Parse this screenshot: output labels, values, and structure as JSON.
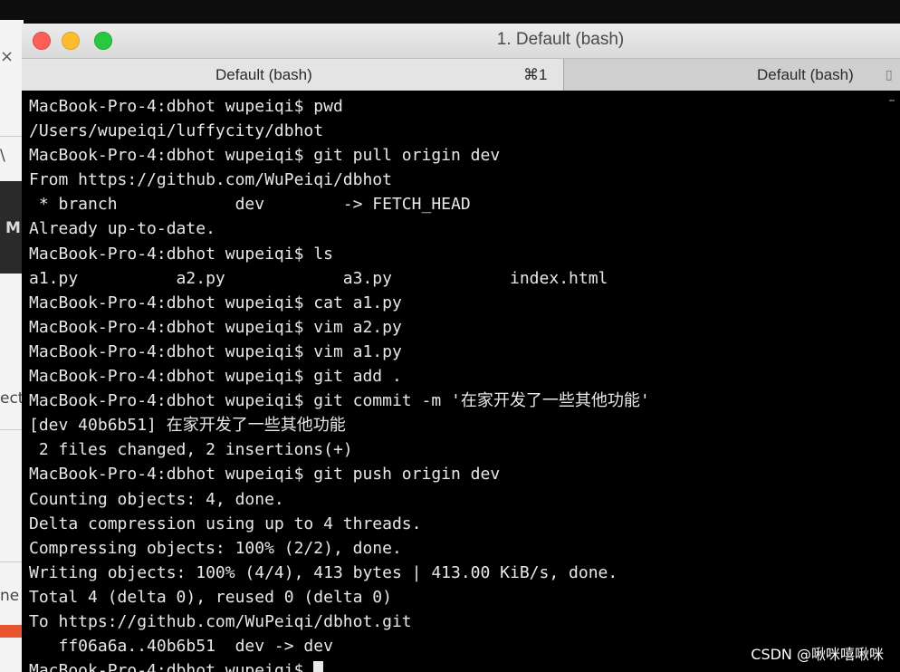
{
  "window": {
    "title": "1. Default (bash)",
    "tabs": [
      {
        "label": "Default (bash)",
        "shortcut": "⌘1"
      },
      {
        "label": "Default (bash)"
      }
    ]
  },
  "background_app": {
    "close_glyph": "×",
    "fragments": [
      "\\",
      "M",
      "ect",
      "ne"
    ]
  },
  "terminal": {
    "lines": [
      "MacBook-Pro-4:dbhot wupeiqi$ pwd",
      "/Users/wupeiqi/luffycity/dbhot",
      "MacBook-Pro-4:dbhot wupeiqi$ git pull origin dev",
      "From https://github.com/WuPeiqi/dbhot",
      " * branch            dev        -> FETCH_HEAD",
      "Already up-to-date.",
      "MacBook-Pro-4:dbhot wupeiqi$ ls",
      "a1.py          a2.py            a3.py            index.html",
      "MacBook-Pro-4:dbhot wupeiqi$ cat a1.py",
      "MacBook-Pro-4:dbhot wupeiqi$ vim a2.py",
      "MacBook-Pro-4:dbhot wupeiqi$ vim a1.py",
      "MacBook-Pro-4:dbhot wupeiqi$ git add .",
      "MacBook-Pro-4:dbhot wupeiqi$ git commit -m '在家开发了一些其他功能'",
      "[dev 40b6b51] 在家开发了一些其他功能",
      " 2 files changed, 2 insertions(+)",
      "MacBook-Pro-4:dbhot wupeiqi$ git push origin dev",
      "Counting objects: 4, done.",
      "Delta compression using up to 4 threads.",
      "Compressing objects: 100% (2/2), done.",
      "Writing objects: 100% (4/4), 413 bytes | 413.00 KiB/s, done.",
      "Total 4 (delta 0), reused 0 (delta 0)",
      "To https://github.com/WuPeiqi/dbhot.git",
      "   ff06a6a..40b6b51  dev -> dev"
    ],
    "prompt": "MacBook-Pro-4:dbhot wupeiqi$ "
  },
  "watermark": "CSDN @啾咪嘻啾咪",
  "colors": {
    "terminal_bg": "#000000",
    "terminal_fg": "#e8e8e8",
    "close": "#fc5f57",
    "minimize": "#fdbc2e",
    "zoom": "#29c840"
  }
}
